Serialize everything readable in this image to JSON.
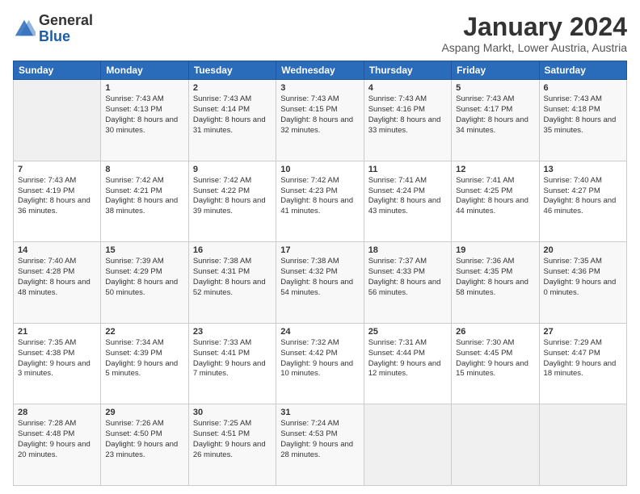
{
  "logo": {
    "general": "General",
    "blue": "Blue"
  },
  "title": "January 2024",
  "subtitle": "Aspang Markt, Lower Austria, Austria",
  "days_header": [
    "Sunday",
    "Monday",
    "Tuesday",
    "Wednesday",
    "Thursday",
    "Friday",
    "Saturday"
  ],
  "weeks": [
    [
      {
        "day": "",
        "empty": true
      },
      {
        "day": "1",
        "sunrise": "7:43 AM",
        "sunset": "4:13 PM",
        "daylight": "8 hours and 30 minutes."
      },
      {
        "day": "2",
        "sunrise": "7:43 AM",
        "sunset": "4:14 PM",
        "daylight": "8 hours and 31 minutes."
      },
      {
        "day": "3",
        "sunrise": "7:43 AM",
        "sunset": "4:15 PM",
        "daylight": "8 hours and 32 minutes."
      },
      {
        "day": "4",
        "sunrise": "7:43 AM",
        "sunset": "4:16 PM",
        "daylight": "8 hours and 33 minutes."
      },
      {
        "day": "5",
        "sunrise": "7:43 AM",
        "sunset": "4:17 PM",
        "daylight": "8 hours and 34 minutes."
      },
      {
        "day": "6",
        "sunrise": "7:43 AM",
        "sunset": "4:18 PM",
        "daylight": "8 hours and 35 minutes."
      }
    ],
    [
      {
        "day": "7",
        "sunrise": "7:43 AM",
        "sunset": "4:19 PM",
        "daylight": "8 hours and 36 minutes."
      },
      {
        "day": "8",
        "sunrise": "7:42 AM",
        "sunset": "4:21 PM",
        "daylight": "8 hours and 38 minutes."
      },
      {
        "day": "9",
        "sunrise": "7:42 AM",
        "sunset": "4:22 PM",
        "daylight": "8 hours and 39 minutes."
      },
      {
        "day": "10",
        "sunrise": "7:42 AM",
        "sunset": "4:23 PM",
        "daylight": "8 hours and 41 minutes."
      },
      {
        "day": "11",
        "sunrise": "7:41 AM",
        "sunset": "4:24 PM",
        "daylight": "8 hours and 43 minutes."
      },
      {
        "day": "12",
        "sunrise": "7:41 AM",
        "sunset": "4:25 PM",
        "daylight": "8 hours and 44 minutes."
      },
      {
        "day": "13",
        "sunrise": "7:40 AM",
        "sunset": "4:27 PM",
        "daylight": "8 hours and 46 minutes."
      }
    ],
    [
      {
        "day": "14",
        "sunrise": "7:40 AM",
        "sunset": "4:28 PM",
        "daylight": "8 hours and 48 minutes."
      },
      {
        "day": "15",
        "sunrise": "7:39 AM",
        "sunset": "4:29 PM",
        "daylight": "8 hours and 50 minutes."
      },
      {
        "day": "16",
        "sunrise": "7:38 AM",
        "sunset": "4:31 PM",
        "daylight": "8 hours and 52 minutes."
      },
      {
        "day": "17",
        "sunrise": "7:38 AM",
        "sunset": "4:32 PM",
        "daylight": "8 hours and 54 minutes."
      },
      {
        "day": "18",
        "sunrise": "7:37 AM",
        "sunset": "4:33 PM",
        "daylight": "8 hours and 56 minutes."
      },
      {
        "day": "19",
        "sunrise": "7:36 AM",
        "sunset": "4:35 PM",
        "daylight": "8 hours and 58 minutes."
      },
      {
        "day": "20",
        "sunrise": "7:35 AM",
        "sunset": "4:36 PM",
        "daylight": "9 hours and 0 minutes."
      }
    ],
    [
      {
        "day": "21",
        "sunrise": "7:35 AM",
        "sunset": "4:38 PM",
        "daylight": "9 hours and 3 minutes."
      },
      {
        "day": "22",
        "sunrise": "7:34 AM",
        "sunset": "4:39 PM",
        "daylight": "9 hours and 5 minutes."
      },
      {
        "day": "23",
        "sunrise": "7:33 AM",
        "sunset": "4:41 PM",
        "daylight": "9 hours and 7 minutes."
      },
      {
        "day": "24",
        "sunrise": "7:32 AM",
        "sunset": "4:42 PM",
        "daylight": "9 hours and 10 minutes."
      },
      {
        "day": "25",
        "sunrise": "7:31 AM",
        "sunset": "4:44 PM",
        "daylight": "9 hours and 12 minutes."
      },
      {
        "day": "26",
        "sunrise": "7:30 AM",
        "sunset": "4:45 PM",
        "daylight": "9 hours and 15 minutes."
      },
      {
        "day": "27",
        "sunrise": "7:29 AM",
        "sunset": "4:47 PM",
        "daylight": "9 hours and 18 minutes."
      }
    ],
    [
      {
        "day": "28",
        "sunrise": "7:28 AM",
        "sunset": "4:48 PM",
        "daylight": "9 hours and 20 minutes."
      },
      {
        "day": "29",
        "sunrise": "7:26 AM",
        "sunset": "4:50 PM",
        "daylight": "9 hours and 23 minutes."
      },
      {
        "day": "30",
        "sunrise": "7:25 AM",
        "sunset": "4:51 PM",
        "daylight": "9 hours and 26 minutes."
      },
      {
        "day": "31",
        "sunrise": "7:24 AM",
        "sunset": "4:53 PM",
        "daylight": "9 hours and 28 minutes."
      },
      {
        "day": "",
        "empty": true
      },
      {
        "day": "",
        "empty": true
      },
      {
        "day": "",
        "empty": true
      }
    ]
  ]
}
